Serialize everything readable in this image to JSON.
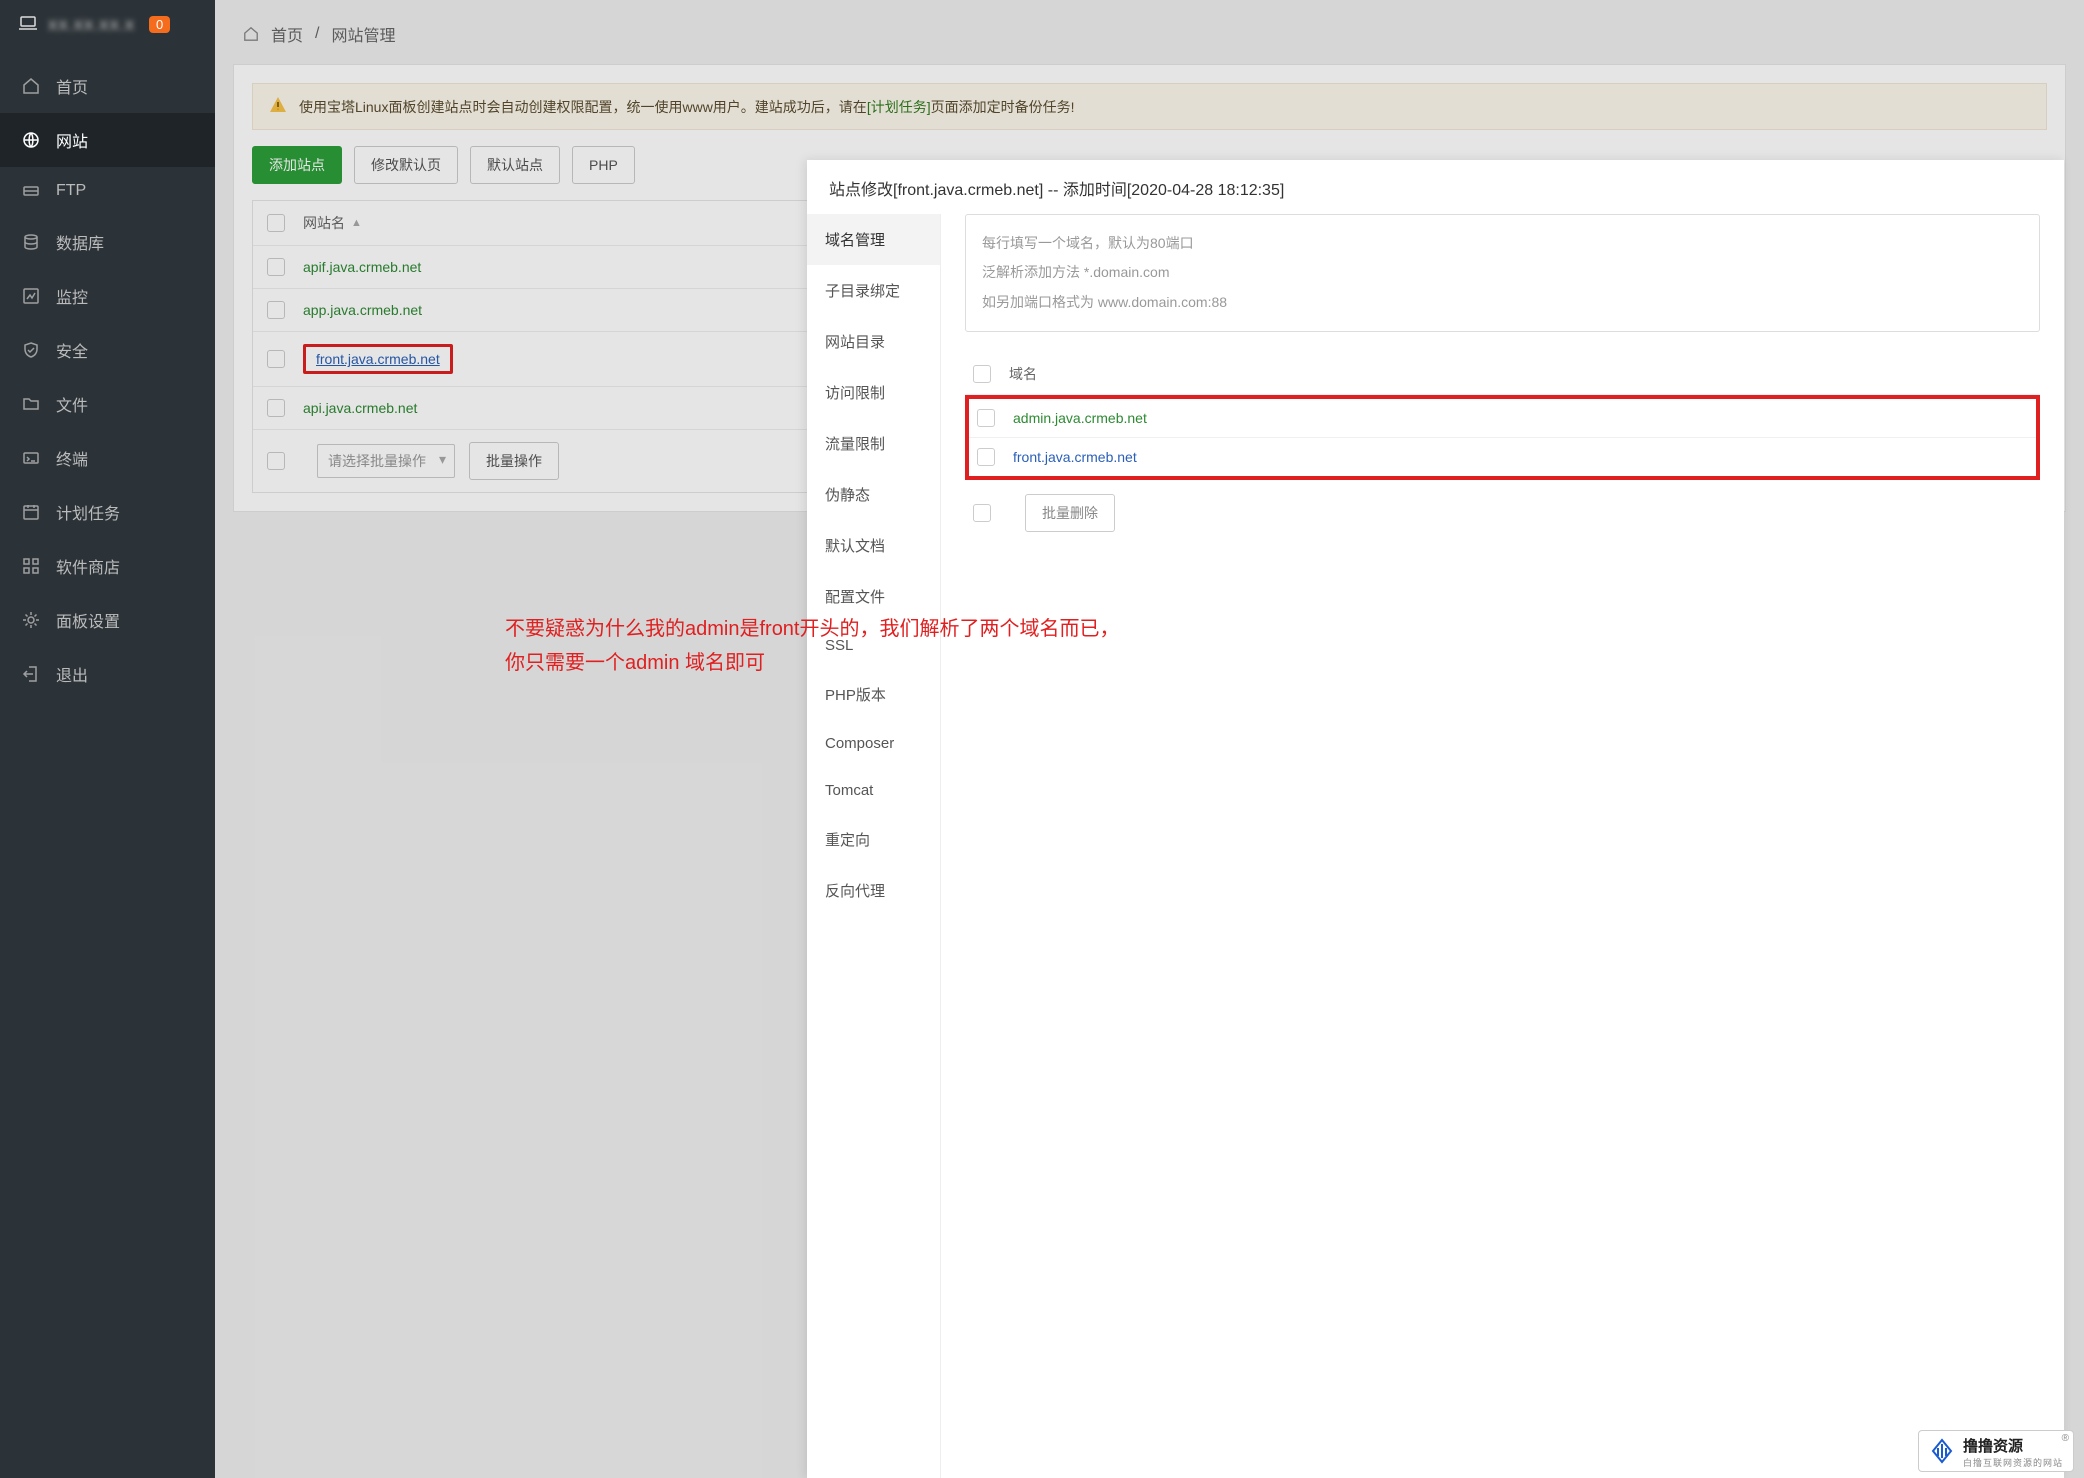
{
  "sidebar": {
    "server_ip_obscured": "XX.XX.XX.X",
    "badge": "0",
    "items": [
      {
        "label": "首页"
      },
      {
        "label": "网站"
      },
      {
        "label": "FTP"
      },
      {
        "label": "数据库"
      },
      {
        "label": "监控"
      },
      {
        "label": "安全"
      },
      {
        "label": "文件"
      },
      {
        "label": "终端"
      },
      {
        "label": "计划任务"
      },
      {
        "label": "软件商店"
      },
      {
        "label": "面板设置"
      },
      {
        "label": "退出"
      }
    ]
  },
  "breadcrumb": {
    "home": "首页",
    "sep": "/",
    "page": "网站管理"
  },
  "alert": {
    "text_before": "使用宝塔Linux面板创建站点时会自动创建权限配置，统一使用www用户。建站成功后，请在",
    "link": "[计划任务]",
    "text_after": "页面添加定时备份任务!"
  },
  "buttons": {
    "add": "添加站点",
    "modify": "修改默认页",
    "default": "默认站点",
    "php": "PHP"
  },
  "table": {
    "header_site": "网站名",
    "sites": [
      {
        "domain": "apif.java.crmeb.net"
      },
      {
        "domain": "app.java.crmeb.net"
      },
      {
        "domain": "front.java.crmeb.net"
      },
      {
        "domain": "api.java.crmeb.net"
      }
    ],
    "bulk_placeholder": "请选择批量操作",
    "bulk_btn": "批量操作"
  },
  "modal": {
    "title": "站点修改[front.java.crmeb.net] -- 添加时间[2020-04-28 18:12:35]",
    "nav": [
      "域名管理",
      "子目录绑定",
      "网站目录",
      "访问限制",
      "流量限制",
      "伪静态",
      "默认文档",
      "配置文件",
      "SSL",
      "PHP版本",
      "Composer",
      "Tomcat",
      "重定向",
      "反向代理"
    ],
    "placeholder_lines": [
      "每行填写一个域名，默认为80端口",
      "泛解析添加方法 *.domain.com",
      "如另加端口格式为 www.domain.com:88"
    ],
    "domain_header": "域名",
    "domains": [
      {
        "name": "admin.java.crmeb.net"
      },
      {
        "name": "front.java.crmeb.net"
      }
    ],
    "batch_delete": "批量删除"
  },
  "red_note": {
    "line1": "不要疑惑为什么我的admin是front开头的，我们解析了两个域名而已，",
    "line2": "你只需要一个admin 域名即可"
  },
  "logo": {
    "title": "撸撸资源",
    "subtitle": "白撸互联网资源的网站",
    "reg": "®"
  }
}
